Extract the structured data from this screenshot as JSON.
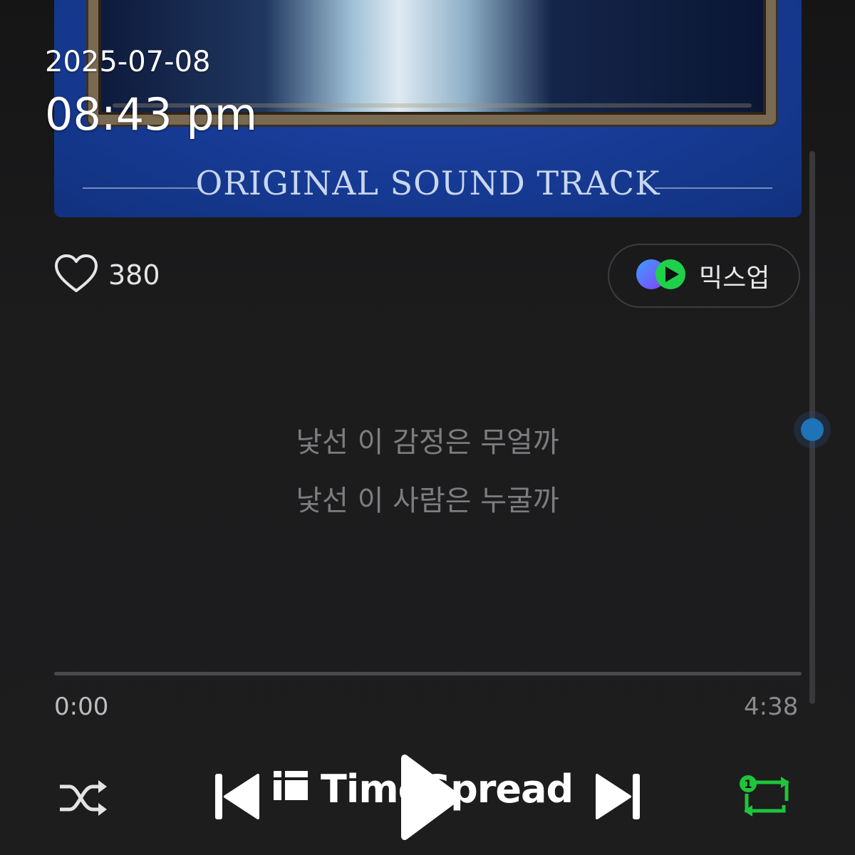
{
  "overlay": {
    "date": "2025-07-08",
    "time": "08:43 pm"
  },
  "album": {
    "subtitle": "ORIGINAL SOUND TRACK"
  },
  "like": {
    "icon": "heart-icon",
    "count": "380"
  },
  "mixup": {
    "icon": "mixup-logo-icon",
    "label": "믹스업"
  },
  "lyrics": {
    "line1": "낯선 이 감정은 무얼까",
    "line2": "낯선 이 사람은 누굴까"
  },
  "playback": {
    "elapsed": "0:00",
    "duration": "4:38",
    "progress_fraction": 0
  },
  "controls": {
    "shuffle_icon": "shuffle-icon",
    "previous_icon": "previous-icon",
    "play_icon": "play-icon",
    "next_icon": "next-icon",
    "repeat_icon": "repeat-one-icon",
    "repeat_badge": "1"
  },
  "watermark": {
    "text": "TimeSpread"
  },
  "colors": {
    "background": "#1c1c1d",
    "album_blue": "#163a92",
    "repeat_green": "#1fc43a",
    "scroll_accent": "#1f73b7"
  }
}
